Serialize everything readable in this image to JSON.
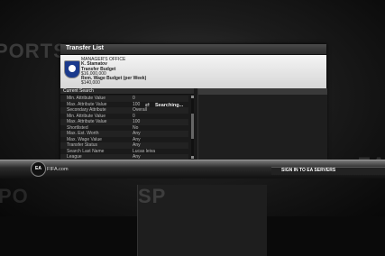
{
  "panel": {
    "title": "Transfer List",
    "office_heading": "MANAGER'S OFFICE",
    "manager_name": "K. Stamatov",
    "transfer_budget_label": "Transfer Budget",
    "transfer_budget_value": "$16,000,000",
    "wage_budget_label": "Rem. Wage Budget (per Week)",
    "wage_budget_value": "$140,000"
  },
  "current_search": {
    "header": "Current Search",
    "rows": [
      {
        "label": "Min. Attribute Value",
        "value": "0"
      },
      {
        "label": "Max. Attribute Value",
        "value": "100"
      },
      {
        "label": "Secondary Attribute",
        "value": "Overall"
      },
      {
        "label": "Min. Attribute Value",
        "value": "0"
      },
      {
        "label": "Max. Attribute Value",
        "value": "100"
      },
      {
        "label": "Shortlisted",
        "value": "No"
      },
      {
        "label": "Max. Est. Worth",
        "value": "Any"
      },
      {
        "label": "Max. Wage Value",
        "value": "Any"
      },
      {
        "label": "Transfer Status",
        "value": "Any"
      },
      {
        "label": "Search Last Name",
        "value": "Lucas leiva"
      },
      {
        "label": "League",
        "value": "Any"
      }
    ]
  },
  "results": {
    "status": "Searching..."
  },
  "footer": {
    "ea_logo": "EA",
    "brand": "FIFA.com",
    "signin": "SIGN IN TO EA SERVERS"
  },
  "background": {
    "left_text": "PORTS",
    "right_text": "SP",
    "right_mid_text": "EA",
    "bottom_left_text": "PO"
  },
  "colors": {
    "panel_bg": "#1a1a1a",
    "info_bg": "#e6e6e6",
    "crest": "#1b3a8c"
  }
}
